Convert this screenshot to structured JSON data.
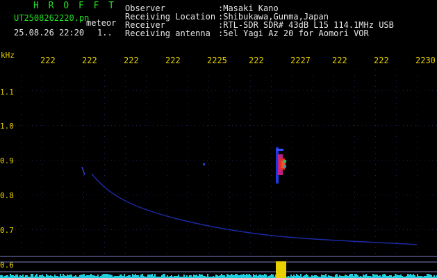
{
  "app": {
    "title": "H R O F F T",
    "filename": "UT2508262220.pn",
    "mode": "meteor",
    "datetime": "25.08.26 22:20",
    "counter": "1.."
  },
  "header": {
    "labels": [
      "Observer",
      "Receiving Location",
      "Receiver",
      "Receiving antenna"
    ],
    "values": [
      ":Masaki Kano",
      ":Shibukawa,Gunma,Japan",
      ":RTL-SDR SDR# 43dB L15 114.1MHz USB",
      ":5el Yagi Az 20 for Aomori VOR"
    ]
  },
  "xaxis": {
    "ticks": [
      "222",
      "222",
      "222",
      "222",
      "2225",
      "222",
      "2227",
      "222",
      "222",
      "2230"
    ]
  },
  "yaxis": {
    "unit": "kHz",
    "ticks": [
      "1.1",
      "1.0",
      "0.9",
      "0.8",
      "0.7",
      "0.6"
    ]
  },
  "colors": {
    "text_green": "#20e020",
    "text_yellow": "#e8d000",
    "grid": "#1c1c4a",
    "signal_blue": "#2030c0",
    "meteor_red": "#e03020",
    "level_cyan": "#20d0e0"
  },
  "icons": {
    "yagi": "antenna-icon"
  }
}
